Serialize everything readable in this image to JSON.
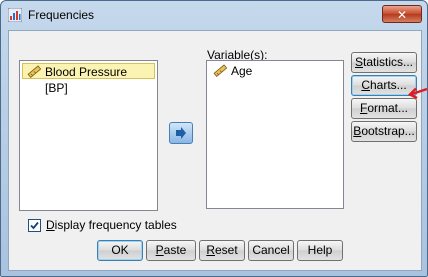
{
  "window": {
    "title": "Frequencies",
    "close_glyph": "✕"
  },
  "source_list": {
    "items": [
      {
        "label": "Blood Pressure [BP]",
        "icon": "ruler-icon",
        "selected": true
      }
    ]
  },
  "variables": {
    "label_key": "V",
    "label_rest": "ariable(s):",
    "items": [
      {
        "label": "Age",
        "icon": "ruler-icon"
      }
    ]
  },
  "side_buttons": {
    "statistics": {
      "key": "S",
      "rest": "tatistics..."
    },
    "charts": {
      "key": "C",
      "rest": "harts..."
    },
    "format": {
      "key": "F",
      "rest": "ormat..."
    },
    "bootstrap": {
      "key": "B",
      "rest": "ootstrap..."
    }
  },
  "checkbox": {
    "key": "D",
    "rest": "isplay frequency tables",
    "checked": true
  },
  "bottom_buttons": {
    "ok": "OK",
    "paste": {
      "key": "P",
      "rest": "aste"
    },
    "reset": {
      "key": "R",
      "rest": "eset"
    },
    "cancel": "Cancel",
    "help": "Help"
  },
  "colors": {
    "annotation_arrow": "#e01b24",
    "selection": "#fbf3b1",
    "title_bar": "#b8cfe8"
  }
}
